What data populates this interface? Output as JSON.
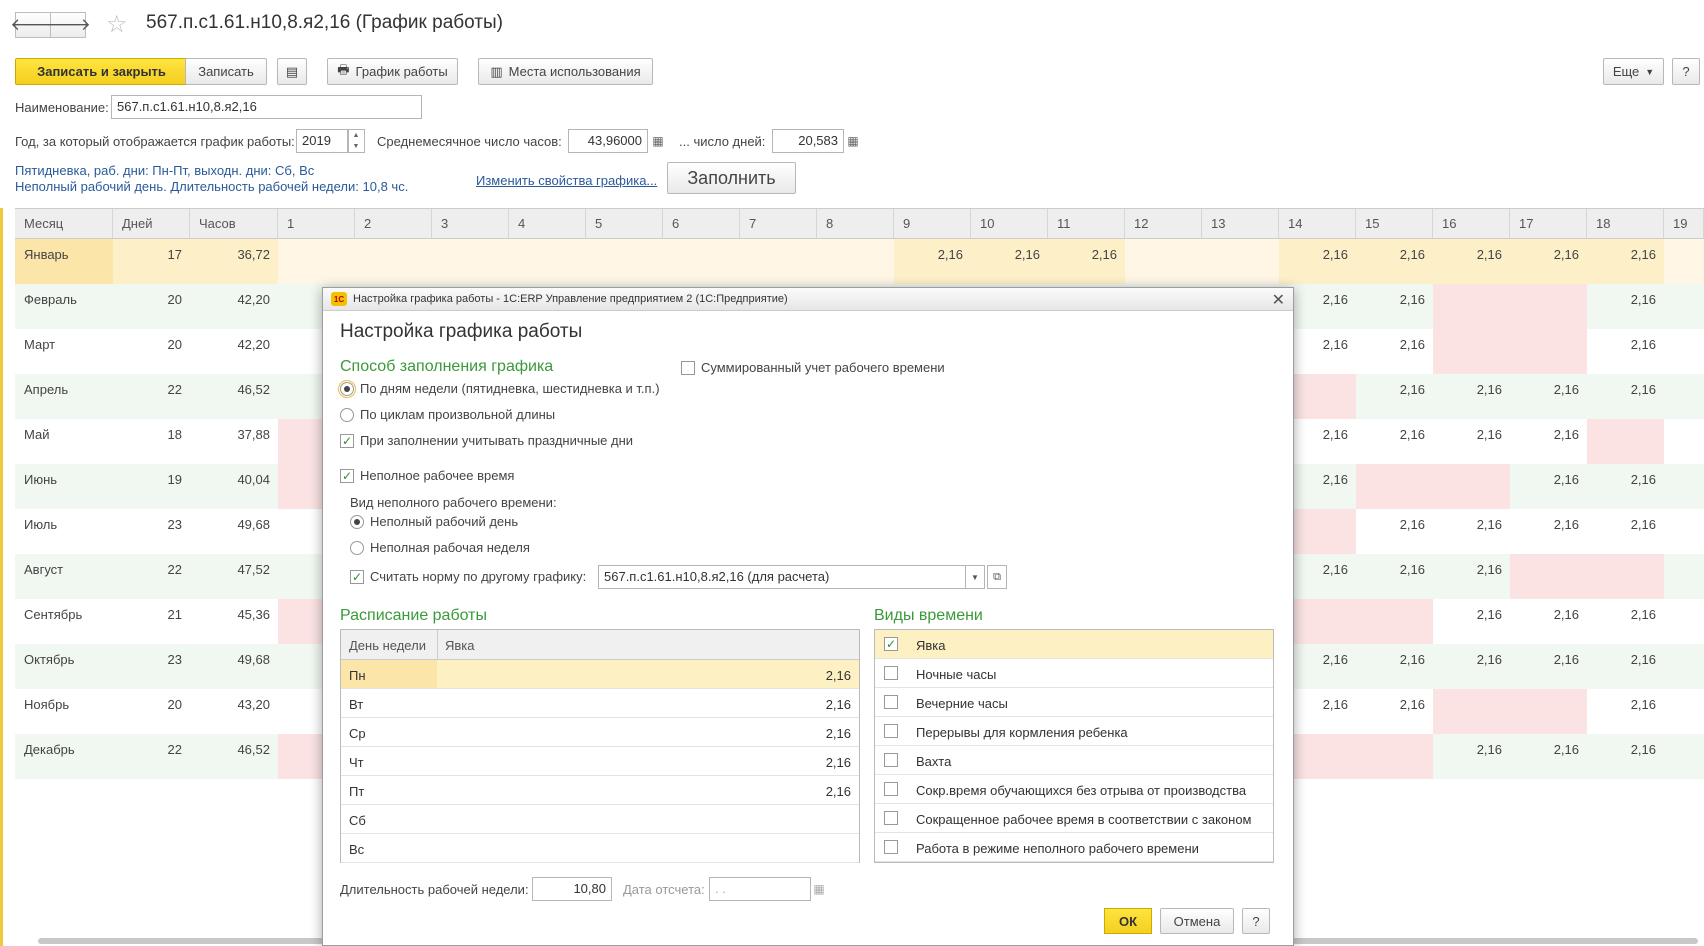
{
  "window": {
    "title": "567.п.с1.61.н10,8.я2,16 (График работы)"
  },
  "toolbar": {
    "save_close": "Записать и закрыть",
    "save": "Записать",
    "schedule": "График работы",
    "usage": "Места использования",
    "more": "Еще",
    "help": "?"
  },
  "form": {
    "name_label": "Наименование:",
    "name_value": "567.п.с1.61.н10,8.я2,16",
    "year_label": "Год, за который отображается график работы:",
    "year_value": "2019",
    "avg_hours_label": "Среднемесячное число часов:",
    "avg_hours_value": "43,96000",
    "days_label": "... число дней:",
    "days_value": "20,583",
    "info_line1": "Пятидневка, раб. дни: Пн-Пт, выходн. дни: Сб, Вс",
    "info_line2": "Неполный рабочий день. Длительность рабочей недели: 10,8 чс.",
    "change_link": "Изменить свойства графика...",
    "fill_button": "Заполнить"
  },
  "grid": {
    "headers": [
      "Месяц",
      "Дней",
      "Часов",
      "1",
      "2",
      "3",
      "4",
      "5",
      "6",
      "7",
      "8",
      "9",
      "10",
      "11",
      "12",
      "13",
      "14",
      "15",
      "16",
      "17",
      "18",
      "19"
    ],
    "rows": [
      {
        "month": "Январь",
        "days": "17",
        "hours": "36,72"
      },
      {
        "month": "Февраль",
        "days": "20",
        "hours": "42,20"
      },
      {
        "month": "Март",
        "days": "20",
        "hours": "42,20"
      },
      {
        "month": "Апрель",
        "days": "22",
        "hours": "46,52"
      },
      {
        "month": "Май",
        "days": "18",
        "hours": "37,88"
      },
      {
        "month": "Июнь",
        "days": "19",
        "hours": "40,04"
      },
      {
        "month": "Июль",
        "days": "23",
        "hours": "49,68"
      },
      {
        "month": "Август",
        "days": "22",
        "hours": "47,52"
      },
      {
        "month": "Сентябрь",
        "days": "21",
        "hours": "45,36"
      },
      {
        "month": "Октябрь",
        "days": "23",
        "hours": "49,68"
      },
      {
        "month": "Ноябрь",
        "days": "20",
        "hours": "43,20"
      },
      {
        "month": "Декабрь",
        "days": "22",
        "hours": "46,52"
      }
    ],
    "cell_value": "2,16",
    "right_cells": [
      [
        "2,16",
        "2,16",
        "2,16",
        "2,16",
        "2,16"
      ],
      [
        "2,16",
        "2,16",
        "",
        "",
        "2,16"
      ],
      [
        "2,16",
        "2,16",
        "",
        "",
        "2,16"
      ],
      [
        "",
        "2,16",
        "2,16",
        "2,16",
        "2,16"
      ],
      [
        "2,16",
        "2,16",
        "2,16",
        "2,16",
        ""
      ],
      [
        "2,16",
        "",
        "",
        "2,16",
        "2,16"
      ],
      [
        "",
        "2,16",
        "2,16",
        "2,16",
        "2,16"
      ],
      [
        "2,16",
        "2,16",
        "2,16",
        "",
        ""
      ],
      [
        "",
        "",
        "2,16",
        "2,16",
        "2,16"
      ],
      [
        "2,16",
        "2,16",
        "2,16",
        "2,16",
        "2,16"
      ],
      [
        "2,16",
        "2,16",
        "",
        "",
        "2,16"
      ],
      [
        "",
        "",
        "2,16",
        "2,16",
        "2,16"
      ]
    ],
    "jan_mid": [
      "2,16",
      "2,16",
      "2,16"
    ]
  },
  "modal": {
    "window_title": "Настройка графика работы - 1С:ERP Управление предприятием 2  (1С:Предприятие)",
    "logo_text": "1С",
    "heading": "Настройка графика работы",
    "fill_method_title": "Способ заполнения графика",
    "opt_weekdays": "По дням недели (пятидневка, шестидневка и т.п.)",
    "opt_cycles": "По циклам произвольной длины",
    "opt_holidays": "При заполнении учитывать праздничные дни",
    "opt_summed": "Суммированный учет рабочего времени",
    "opt_parttime": "Неполное рабочее время",
    "parttime_type_label": "Вид неполного рабочего времени:",
    "opt_partday": "Неполный рабочий день",
    "opt_partweek": "Неполная рабочая неделя",
    "opt_norm": "Считать норму по другому графику:",
    "norm_value": "567.п.с1.61.н10,8.я2,16 (для расчета)",
    "schedule_title": "Расписание работы",
    "schedule_headers": [
      "День недели",
      "Явка"
    ],
    "schedule_rows": [
      {
        "day": "Пн",
        "val": "2,16"
      },
      {
        "day": "Вт",
        "val": "2,16"
      },
      {
        "day": "Ср",
        "val": "2,16"
      },
      {
        "day": "Чт",
        "val": "2,16"
      },
      {
        "day": "Пт",
        "val": "2,16"
      },
      {
        "day": "Сб",
        "val": ""
      },
      {
        "day": "Вс",
        "val": ""
      }
    ],
    "time_types_title": "Виды времени",
    "time_types": [
      "Явка",
      "Ночные часы",
      "Вечерние часы",
      "Перерывы для кормления ребенка",
      "Вахта",
      "Сокр.время обучающихся без отрыва от производства",
      "Сокращенное рабочее время в соответствии с законом",
      "Работа в режиме неполного рабочего времени"
    ],
    "week_len_label": "Длительность рабочей недели:",
    "week_len_value": "10,80",
    "date_label": "Дата отсчета:",
    "date_value": " .  .",
    "ok": "ОК",
    "cancel": "Отмена",
    "help": "?"
  },
  "colors": {
    "accent_yellow": "#f4cf1f",
    "weekend_pink": "#fbe3e3",
    "workday_green": "#f1f8f1",
    "section_green": "#3a9a3a",
    "link_blue": "#2a5a9b"
  }
}
